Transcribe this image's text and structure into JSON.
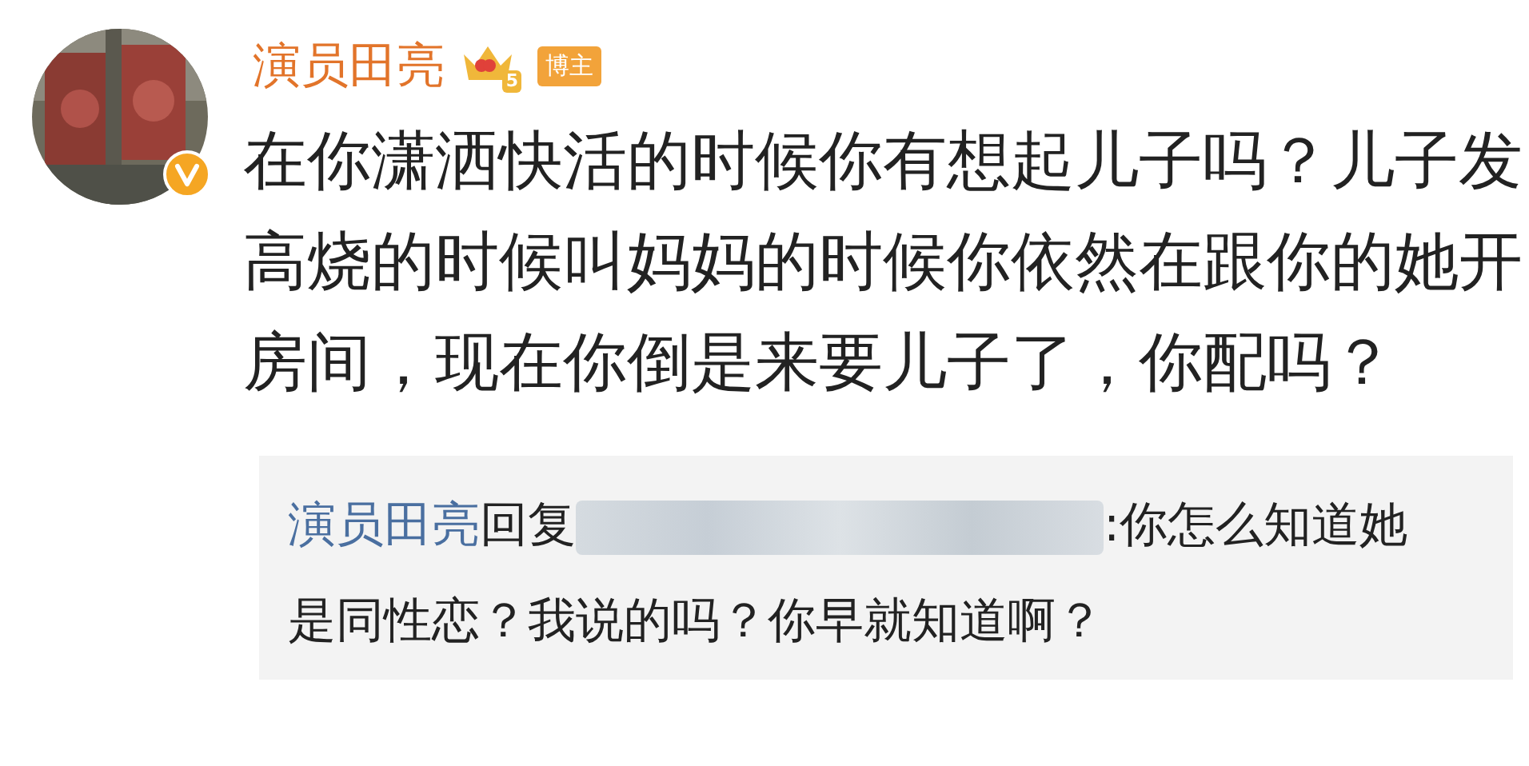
{
  "post": {
    "author": "演员田亮",
    "verified": true,
    "crown_level": "5",
    "badge": "博主",
    "text": "在你潇洒快活的时候你有想起儿子吗？儿子发高烧的时候叫妈妈的时候你依然在跟你的她开房间，现在你倒是来要儿子了，你配吗？"
  },
  "reply": {
    "author": "演员田亮",
    "action": "回复",
    "text": ":你怎么知道她是同性恋？我说的吗？你早就知道啊？"
  }
}
